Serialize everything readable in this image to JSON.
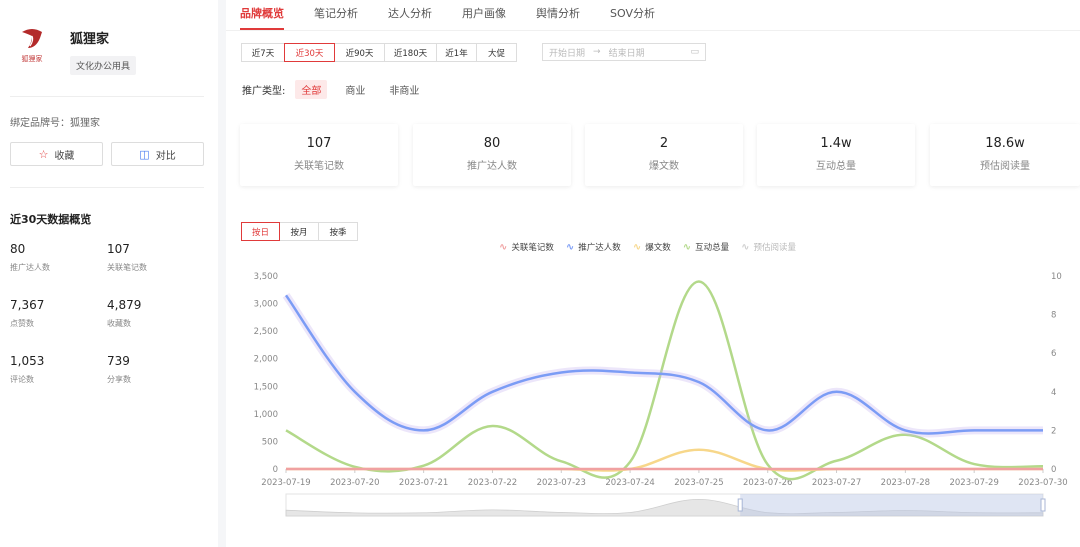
{
  "brand": {
    "logo_text": "狐狸家",
    "name": "狐狸家",
    "tag": "文化办公用具"
  },
  "sidebar": {
    "bind_label": "绑定品牌号：狐狸家",
    "favorite_label": "收藏",
    "compare_label": "对比",
    "overview_title": "近30天数据概览",
    "stats": [
      {
        "value": "80",
        "label": "推广达人数"
      },
      {
        "value": "107",
        "label": "关联笔记数"
      },
      {
        "value": "7,367",
        "label": "点赞数"
      },
      {
        "value": "4,879",
        "label": "收藏数"
      },
      {
        "value": "1,053",
        "label": "评论数"
      },
      {
        "value": "739",
        "label": "分享数"
      }
    ]
  },
  "tabs": [
    "品牌概览",
    "笔记分析",
    "达人分析",
    "用户画像",
    "舆情分析",
    "SOV分析"
  ],
  "active_tab": 0,
  "range_options": [
    "近7天",
    "近30天",
    "近90天",
    "近180天",
    "近1年",
    "大促"
  ],
  "date_range": {
    "start_placeholder": "开始日期",
    "end_placeholder": "结束日期"
  },
  "promo": {
    "label": "推广类型:",
    "options": [
      "全部",
      "商业",
      "非商业"
    ]
  },
  "cards": [
    {
      "value": "107",
      "label": "关联笔记数"
    },
    {
      "value": "80",
      "label": "推广达人数"
    },
    {
      "value": "2",
      "label": "爆文数"
    },
    {
      "value": "1.4w",
      "label": "互动总量"
    },
    {
      "value": "18.6w",
      "label": "预估阅读量"
    }
  ],
  "granularity": [
    "按日",
    "按月",
    "按季"
  ],
  "colors": {
    "accent": "#e03a3a",
    "blue": "#7b9cf5",
    "green": "#b3d98a",
    "yellow": "#f7d78a",
    "red": "#f0a1a1",
    "gray": "#cfcfcf"
  },
  "chart_data": {
    "type": "line",
    "x": [
      "2023-07-19",
      "2023-07-20",
      "2023-07-21",
      "2023-07-22",
      "2023-07-23",
      "2023-07-24",
      "2023-07-25",
      "2023-07-26",
      "2023-07-27",
      "2023-07-28",
      "2023-07-29",
      "2023-07-30"
    ],
    "left_ticks": [
      "0",
      "500",
      "1,000",
      "1,500",
      "2,000",
      "2,500",
      "3,000",
      "3,500"
    ],
    "right_ticks": [
      "0",
      "2",
      "4",
      "6",
      "8",
      "10"
    ],
    "ylim_left": [
      0,
      3500
    ],
    "ylim_right": [
      0,
      10
    ],
    "series": [
      {
        "name": "关联笔记数",
        "axis": "right",
        "color": "red",
        "visible": true,
        "values": [
          0,
          0,
          0,
          0,
          0,
          0,
          0,
          0,
          0,
          0,
          0,
          0
        ]
      },
      {
        "name": "推广达人数",
        "axis": "right",
        "color": "blue",
        "visible": true,
        "values": [
          9,
          4,
          2,
          4,
          5,
          5,
          4.5,
          2,
          4,
          2,
          2,
          2
        ]
      },
      {
        "name": "爆文数",
        "axis": "right",
        "color": "yellow",
        "visible": true,
        "values": [
          0,
          0,
          0,
          0,
          0,
          0,
          1,
          0,
          0,
          0,
          0,
          0
        ]
      },
      {
        "name": "互动总量",
        "axis": "left",
        "color": "green",
        "visible": true,
        "values": [
          700,
          40,
          60,
          780,
          140,
          130,
          3400,
          80,
          150,
          620,
          90,
          50
        ]
      },
      {
        "name": "预估阅读量",
        "axis": "left",
        "color": "gray",
        "visible": false,
        "values": []
      }
    ]
  }
}
